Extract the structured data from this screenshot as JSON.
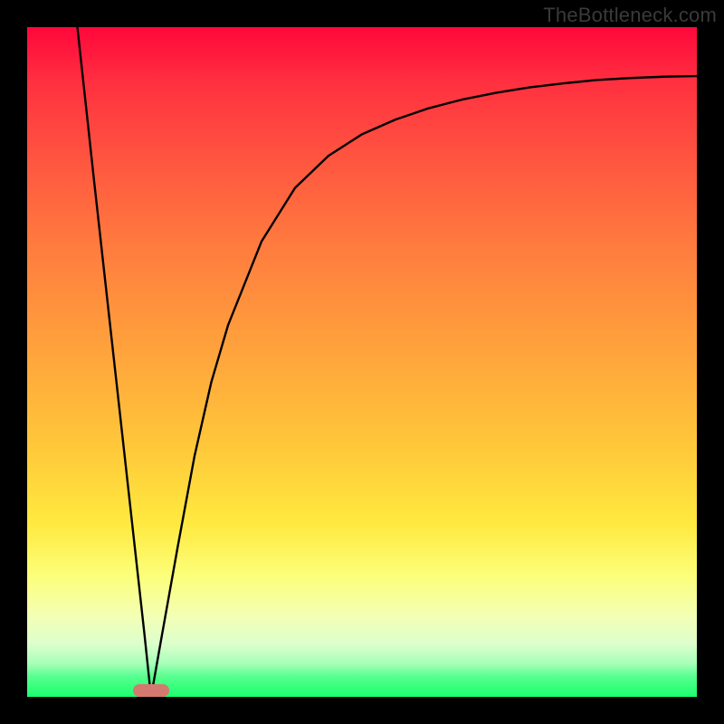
{
  "watermark": "TheBottleneck.com",
  "marker": {
    "x_frac": 0.185,
    "width_frac": 0.054,
    "color": "#d4796f"
  },
  "chart_data": {
    "type": "line",
    "title": "",
    "xlabel": "",
    "ylabel": "",
    "xlim": [
      0,
      1
    ],
    "ylim": [
      0,
      1
    ],
    "gradient_stops": [
      {
        "pos": 0.0,
        "color": "#ff073b"
      },
      {
        "pos": 0.08,
        "color": "#ff2f40"
      },
      {
        "pos": 0.2,
        "color": "#ff5640"
      },
      {
        "pos": 0.34,
        "color": "#ff7f3e"
      },
      {
        "pos": 0.48,
        "color": "#ffa23c"
      },
      {
        "pos": 0.62,
        "color": "#ffc63a"
      },
      {
        "pos": 0.74,
        "color": "#ffe93f"
      },
      {
        "pos": 0.82,
        "color": "#fcff7a"
      },
      {
        "pos": 0.88,
        "color": "#f3ffb5"
      },
      {
        "pos": 0.92,
        "color": "#ddffcc"
      },
      {
        "pos": 0.95,
        "color": "#a8ffb9"
      },
      {
        "pos": 0.97,
        "color": "#56ff8e"
      },
      {
        "pos": 1.0,
        "color": "#1bff6e"
      }
    ],
    "series": [
      {
        "name": "curve",
        "stroke": "#000000",
        "stroke_width": 2.4,
        "x": [
          0.075,
          0.1,
          0.125,
          0.15,
          0.175,
          0.185,
          0.2,
          0.225,
          0.25,
          0.275,
          0.3,
          0.35,
          0.4,
          0.45,
          0.5,
          0.55,
          0.6,
          0.65,
          0.7,
          0.75,
          0.8,
          0.85,
          0.9,
          0.95,
          1.0
        ],
        "y": [
          1.0,
          0.77,
          0.545,
          0.32,
          0.095,
          0.0,
          0.085,
          0.225,
          0.36,
          0.47,
          0.555,
          0.68,
          0.76,
          0.808,
          0.84,
          0.862,
          0.879,
          0.892,
          0.902,
          0.91,
          0.916,
          0.921,
          0.924,
          0.926,
          0.927
        ]
      }
    ]
  }
}
